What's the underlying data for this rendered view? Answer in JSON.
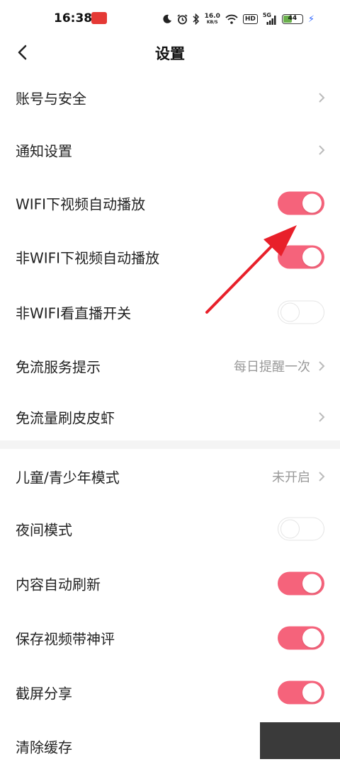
{
  "status_bar": {
    "time": "16:38",
    "app_badge_icon": "red-app-icon",
    "speed_value": "16.0",
    "speed_unit": "KB/S",
    "hd": "HD",
    "network": "5G",
    "battery": "44",
    "icons": [
      "moon-icon",
      "alarm-icon",
      "bluetooth-icon",
      "wifi-icon",
      "signal-icon",
      "battery-icon",
      "charging-icon"
    ]
  },
  "header": {
    "title": "设置",
    "back_icon": "chevron-left-icon"
  },
  "settings": [
    {
      "label": "账号与安全",
      "type": "link",
      "value": ""
    },
    {
      "label": "通知设置",
      "type": "link",
      "value": ""
    },
    {
      "label": "WIFI下视频自动播放",
      "type": "toggle",
      "on": true
    },
    {
      "label": "非WIFI下视频自动播放",
      "type": "toggle",
      "on": true
    },
    {
      "label": "非WIFI看直播开关",
      "type": "toggle",
      "on": false
    },
    {
      "label": "免流服务提示",
      "type": "link",
      "value": "每日提醒一次"
    },
    {
      "label": "免流量刷皮皮虾",
      "type": "link",
      "value": ""
    },
    {
      "label": "儿童/青少年模式",
      "type": "link",
      "value": "未开启"
    },
    {
      "label": "夜间模式",
      "type": "toggle",
      "on": false
    },
    {
      "label": "内容自动刷新",
      "type": "toggle",
      "on": true
    },
    {
      "label": "保存视频带神评",
      "type": "toggle",
      "on": true
    },
    {
      "label": "截屏分享",
      "type": "toggle",
      "on": true
    },
    {
      "label": "清除缓存",
      "type": "link",
      "value": ""
    }
  ],
  "colors": {
    "toggle_on": "#f5637b",
    "annotation_arrow": "#e8202a"
  }
}
